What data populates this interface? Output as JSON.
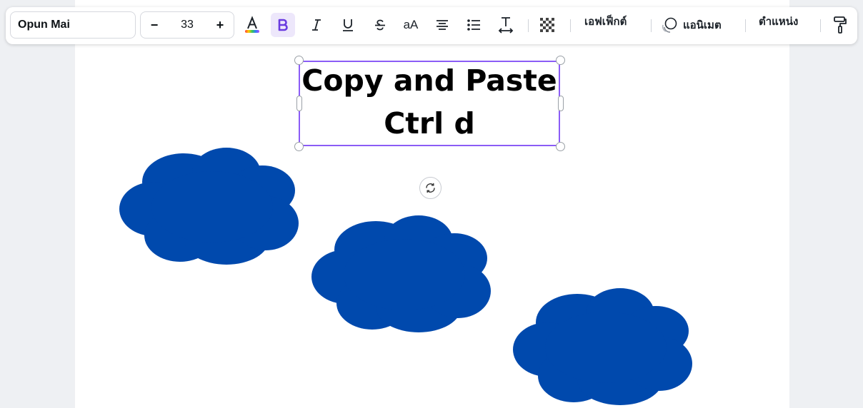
{
  "toolbar": {
    "font_family": "Opun Mai",
    "font_size": "33",
    "decrease_label": "−",
    "increase_label": "+",
    "case_label": "aA",
    "effects_label": "เอฟเฟ็กต์",
    "animate_label": "แอนิเมต",
    "position_label": "ตำแหน่ง",
    "bold_active": true
  },
  "canvas": {
    "text_line_1": "Copy  and  Paste",
    "text_line_2": "Ctrl d",
    "shape_color": "#0049ad",
    "selection_color": "#8b5cf6"
  }
}
